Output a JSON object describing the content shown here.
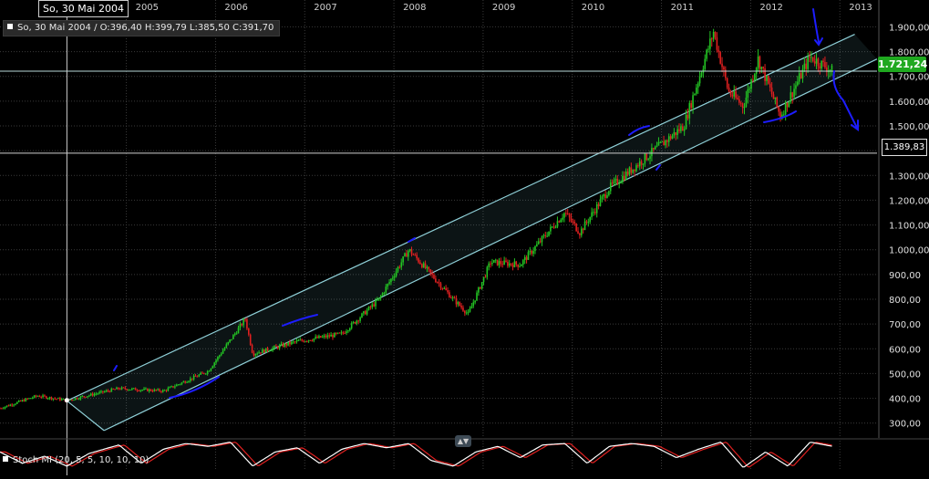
{
  "header": {
    "crosshair_date": "So, 30 Mai 2004",
    "ohlc_text": "So, 30 Mai 2004 / O:396,40  H:399,79  L:385,50  C:391,70"
  },
  "price_tags": {
    "last_price": "1.721,24",
    "crosshair_price": "1.389,83"
  },
  "indicator": {
    "label": "Stoch MI (20, 5, 5, 10, 10, 10)"
  },
  "colors": {
    "background": "#000000",
    "grid": "#3a3a3a",
    "up_candle": "#23c423",
    "down_candle": "#e02020",
    "channel": "#8fd0d8",
    "annotation": "#1d1dff",
    "stoch_k": "#ffffff",
    "stoch_d": "#e02020",
    "last_price_tag": "#1fa81f"
  },
  "chart_data": {
    "type": "candlestick",
    "x_axis": {
      "type": "time",
      "tick_labels": [
        "2005",
        "2006",
        "2007",
        "2008",
        "2009",
        "2010",
        "2011",
        "2012",
        "2013"
      ],
      "range": [
        "2003-08",
        "2013-06"
      ]
    },
    "y_axis": {
      "position": "right",
      "tick_values": [
        300,
        400,
        500,
        600,
        700,
        800,
        900,
        1000,
        1100,
        1200,
        1300,
        1400,
        1500,
        1600,
        1700,
        1800,
        1900
      ],
      "tick_labels": [
        "300,00",
        "400,00",
        "500,00",
        "600,00",
        "700,00",
        "800,00",
        "900,00",
        "1.000,00",
        "1.100,00",
        "1.200,00",
        "1.300,00",
        "",
        "1.500,00",
        "1.600,00",
        "1.700,00",
        "1.800,00",
        "1.900,00"
      ],
      "range": [
        240,
        1990
      ]
    },
    "grid": true,
    "series": [
      {
        "name": "price",
        "points": [
          [
            "2003-08",
            360
          ],
          [
            "2004-01",
            410
          ],
          [
            "2004-05",
            392
          ],
          [
            "2004-12",
            440
          ],
          [
            "2005-06",
            430
          ],
          [
            "2005-12",
            510
          ],
          [
            "2006-05",
            720
          ],
          [
            "2006-06",
            580
          ],
          [
            "2006-12",
            630
          ],
          [
            "2007-06",
            660
          ],
          [
            "2007-11",
            800
          ],
          [
            "2008-03",
            1000
          ],
          [
            "2008-09",
            800
          ],
          [
            "2008-11",
            740
          ],
          [
            "2009-02",
            950
          ],
          [
            "2009-06",
            940
          ],
          [
            "2009-12",
            1150
          ],
          [
            "2010-02",
            1070
          ],
          [
            "2010-06",
            1250
          ],
          [
            "2010-12",
            1400
          ],
          [
            "2011-04",
            1500
          ],
          [
            "2011-08",
            1880
          ],
          [
            "2011-10",
            1640
          ],
          [
            "2011-12",
            1580
          ],
          [
            "2012-02",
            1770
          ],
          [
            "2012-05",
            1540
          ],
          [
            "2012-09",
            1780
          ],
          [
            "2012-10",
            1760
          ],
          [
            "2012-12",
            1721
          ]
        ]
      }
    ],
    "channel_lines": [
      {
        "from": [
          "2004-05",
          390
        ],
        "to": [
          "2013-03",
          1870
        ]
      },
      {
        "from": [
          "2004-10",
          270
        ],
        "to": [
          "2013-06",
          1770
        ]
      }
    ],
    "horizontal_lines": [
      1721.24,
      1389.83
    ],
    "stochastic": {
      "name": "Stoch MI (20, 5, 5, 10, 10, 10)",
      "range": [
        0,
        100
      ],
      "k": [
        [
          "2003-08",
          60
        ],
        [
          "2003-11",
          20
        ],
        [
          "2004-02",
          45
        ],
        [
          "2004-05",
          10
        ],
        [
          "2004-08",
          55
        ],
        [
          "2004-12",
          85
        ],
        [
          "2005-03",
          20
        ],
        [
          "2005-06",
          70
        ],
        [
          "2005-09",
          90
        ],
        [
          "2005-12",
          80
        ],
        [
          "2006-03",
          95
        ],
        [
          "2006-06",
          10
        ],
        [
          "2006-09",
          60
        ],
        [
          "2006-12",
          75
        ],
        [
          "2007-03",
          20
        ],
        [
          "2007-06",
          70
        ],
        [
          "2007-09",
          90
        ],
        [
          "2007-12",
          75
        ],
        [
          "2008-03",
          90
        ],
        [
          "2008-06",
          30
        ],
        [
          "2008-09",
          10
        ],
        [
          "2008-12",
          60
        ],
        [
          "2009-03",
          80
        ],
        [
          "2009-06",
          40
        ],
        [
          "2009-09",
          85
        ],
        [
          "2009-12",
          90
        ],
        [
          "2010-03",
          20
        ],
        [
          "2010-06",
          80
        ],
        [
          "2010-09",
          90
        ],
        [
          "2010-12",
          80
        ],
        [
          "2011-03",
          40
        ],
        [
          "2011-06",
          70
        ],
        [
          "2011-09",
          95
        ],
        [
          "2011-12",
          5
        ],
        [
          "2012-03",
          60
        ],
        [
          "2012-06",
          10
        ],
        [
          "2012-09",
          95
        ],
        [
          "2012-12",
          80
        ]
      ]
    }
  }
}
